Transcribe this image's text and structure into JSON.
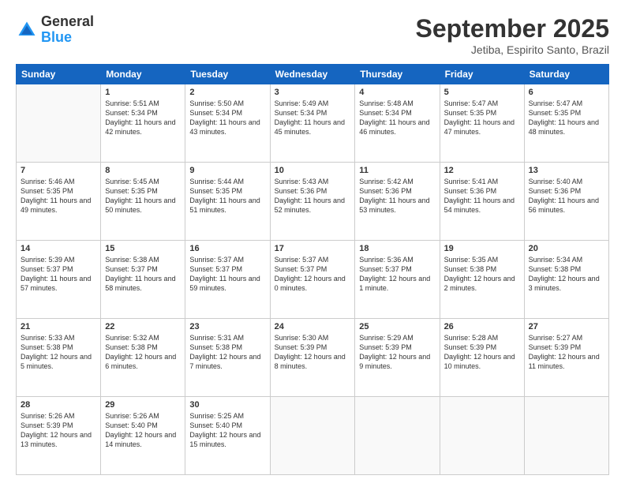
{
  "header": {
    "logo_general": "General",
    "logo_blue": "Blue",
    "month_title": "September 2025",
    "location": "Jetiba, Espirito Santo, Brazil"
  },
  "days_of_week": [
    "Sunday",
    "Monday",
    "Tuesday",
    "Wednesday",
    "Thursday",
    "Friday",
    "Saturday"
  ],
  "weeks": [
    [
      {
        "day": "",
        "info": ""
      },
      {
        "day": "1",
        "info": "Sunrise: 5:51 AM\nSunset: 5:34 PM\nDaylight: 11 hours\nand 42 minutes."
      },
      {
        "day": "2",
        "info": "Sunrise: 5:50 AM\nSunset: 5:34 PM\nDaylight: 11 hours\nand 43 minutes."
      },
      {
        "day": "3",
        "info": "Sunrise: 5:49 AM\nSunset: 5:34 PM\nDaylight: 11 hours\nand 45 minutes."
      },
      {
        "day": "4",
        "info": "Sunrise: 5:48 AM\nSunset: 5:34 PM\nDaylight: 11 hours\nand 46 minutes."
      },
      {
        "day": "5",
        "info": "Sunrise: 5:47 AM\nSunset: 5:35 PM\nDaylight: 11 hours\nand 47 minutes."
      },
      {
        "day": "6",
        "info": "Sunrise: 5:47 AM\nSunset: 5:35 PM\nDaylight: 11 hours\nand 48 minutes."
      }
    ],
    [
      {
        "day": "7",
        "info": "Sunrise: 5:46 AM\nSunset: 5:35 PM\nDaylight: 11 hours\nand 49 minutes."
      },
      {
        "day": "8",
        "info": "Sunrise: 5:45 AM\nSunset: 5:35 PM\nDaylight: 11 hours\nand 50 minutes."
      },
      {
        "day": "9",
        "info": "Sunrise: 5:44 AM\nSunset: 5:35 PM\nDaylight: 11 hours\nand 51 minutes."
      },
      {
        "day": "10",
        "info": "Sunrise: 5:43 AM\nSunset: 5:36 PM\nDaylight: 11 hours\nand 52 minutes."
      },
      {
        "day": "11",
        "info": "Sunrise: 5:42 AM\nSunset: 5:36 PM\nDaylight: 11 hours\nand 53 minutes."
      },
      {
        "day": "12",
        "info": "Sunrise: 5:41 AM\nSunset: 5:36 PM\nDaylight: 11 hours\nand 54 minutes."
      },
      {
        "day": "13",
        "info": "Sunrise: 5:40 AM\nSunset: 5:36 PM\nDaylight: 11 hours\nand 56 minutes."
      }
    ],
    [
      {
        "day": "14",
        "info": "Sunrise: 5:39 AM\nSunset: 5:37 PM\nDaylight: 11 hours\nand 57 minutes."
      },
      {
        "day": "15",
        "info": "Sunrise: 5:38 AM\nSunset: 5:37 PM\nDaylight: 11 hours\nand 58 minutes."
      },
      {
        "day": "16",
        "info": "Sunrise: 5:37 AM\nSunset: 5:37 PM\nDaylight: 11 hours\nand 59 minutes."
      },
      {
        "day": "17",
        "info": "Sunrise: 5:37 AM\nSunset: 5:37 PM\nDaylight: 12 hours\nand 0 minutes."
      },
      {
        "day": "18",
        "info": "Sunrise: 5:36 AM\nSunset: 5:37 PM\nDaylight: 12 hours\nand 1 minute."
      },
      {
        "day": "19",
        "info": "Sunrise: 5:35 AM\nSunset: 5:38 PM\nDaylight: 12 hours\nand 2 minutes."
      },
      {
        "day": "20",
        "info": "Sunrise: 5:34 AM\nSunset: 5:38 PM\nDaylight: 12 hours\nand 3 minutes."
      }
    ],
    [
      {
        "day": "21",
        "info": "Sunrise: 5:33 AM\nSunset: 5:38 PM\nDaylight: 12 hours\nand 5 minutes."
      },
      {
        "day": "22",
        "info": "Sunrise: 5:32 AM\nSunset: 5:38 PM\nDaylight: 12 hours\nand 6 minutes."
      },
      {
        "day": "23",
        "info": "Sunrise: 5:31 AM\nSunset: 5:38 PM\nDaylight: 12 hours\nand 7 minutes."
      },
      {
        "day": "24",
        "info": "Sunrise: 5:30 AM\nSunset: 5:39 PM\nDaylight: 12 hours\nand 8 minutes."
      },
      {
        "day": "25",
        "info": "Sunrise: 5:29 AM\nSunset: 5:39 PM\nDaylight: 12 hours\nand 9 minutes."
      },
      {
        "day": "26",
        "info": "Sunrise: 5:28 AM\nSunset: 5:39 PM\nDaylight: 12 hours\nand 10 minutes."
      },
      {
        "day": "27",
        "info": "Sunrise: 5:27 AM\nSunset: 5:39 PM\nDaylight: 12 hours\nand 11 minutes."
      }
    ],
    [
      {
        "day": "28",
        "info": "Sunrise: 5:26 AM\nSunset: 5:39 PM\nDaylight: 12 hours\nand 13 minutes."
      },
      {
        "day": "29",
        "info": "Sunrise: 5:26 AM\nSunset: 5:40 PM\nDaylight: 12 hours\nand 14 minutes."
      },
      {
        "day": "30",
        "info": "Sunrise: 5:25 AM\nSunset: 5:40 PM\nDaylight: 12 hours\nand 15 minutes."
      },
      {
        "day": "",
        "info": ""
      },
      {
        "day": "",
        "info": ""
      },
      {
        "day": "",
        "info": ""
      },
      {
        "day": "",
        "info": ""
      }
    ]
  ]
}
